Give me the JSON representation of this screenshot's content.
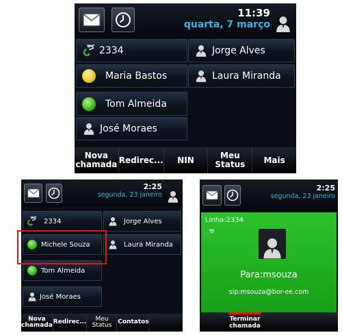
{
  "phone1": {
    "time": "11:39",
    "date": "quarta, 7 março",
    "lines": {
      "own": "2334",
      "c1": "Maria Bastos",
      "c2": "Tom Almeida",
      "c3": "José Moraes",
      "c4": "Jorge Alves",
      "c5": "Laura Miranda"
    },
    "softkeys": [
      "Nova chamada",
      "Redirec...",
      "NIN",
      "Meu Status",
      "Mais"
    ]
  },
  "phone2": {
    "time": "2:25",
    "date": "segunda, 23 janeiro",
    "lines": {
      "own": "2334",
      "c1": "Michele Souza",
      "c2": "Tom Almeida",
      "c3": "José Moraes",
      "c4": "Jorge Alves",
      "c5": "Laura Miranda"
    },
    "softkeys": [
      "Nova chamada",
      "Redirec...",
      "Meu Status",
      "Contatos"
    ]
  },
  "phone3": {
    "time": "2:25",
    "date": "segunda, 23 janeiro",
    "line_label": "Linha:2334",
    "to": "Para:msouza",
    "sip": "sip:msouza@bor-ee.com",
    "softkeys": [
      "Terminar chamada"
    ]
  },
  "icons": [
    "envelope-icon",
    "clock-icon",
    "person-icon",
    "phone-icon",
    "presence-icon"
  ],
  "colors": {
    "date_blue": "#3fb2e6",
    "call_green": "#22b322",
    "highlight_red": "#e01818"
  }
}
